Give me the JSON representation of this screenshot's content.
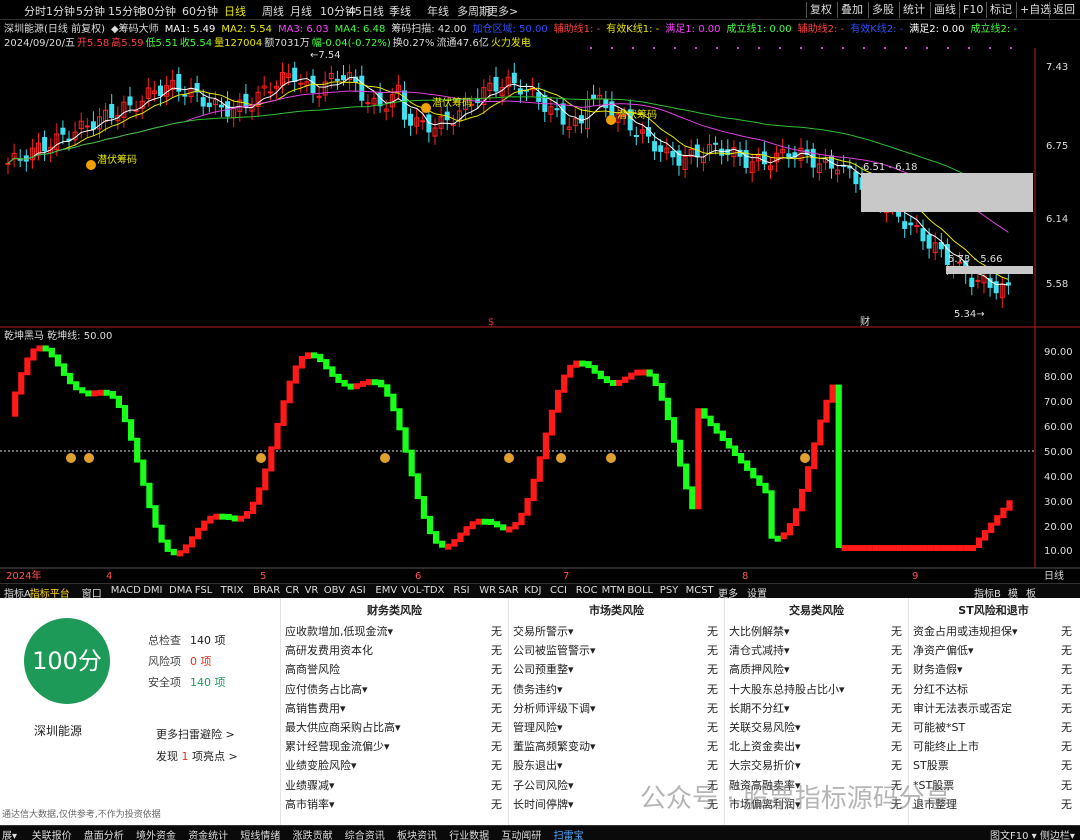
{
  "app": {
    "window_title": "深圳能源(日线 前复权)"
  },
  "periods": [
    "分时",
    "1分钟",
    "5分钟",
    "15分钟",
    "30分钟",
    "60分钟",
    "日线",
    "周线",
    "月线",
    "10分钟",
    "45日线",
    "季线",
    "年线",
    "多周期",
    "更多>"
  ],
  "active_period": "日线",
  "right_buttons": [
    "复权",
    "叠加",
    "多股",
    "统计",
    "画线",
    "F10",
    "标记",
    "+自选",
    "返回"
  ],
  "indicator_line": [
    {
      "t": "深圳能源(日线 前复权)",
      "c": "#dddddd"
    },
    {
      "t": "◆筹码大师",
      "c": "#dddddd"
    },
    {
      "t": "MA1: 5.49",
      "c": "#ffffff"
    },
    {
      "t": "MA2: 5.54",
      "c": "#e8e800"
    },
    {
      "t": "MA3: 6.03",
      "c": "#ff40ff"
    },
    {
      "t": "MA4: 6.48",
      "c": "#40ff40"
    },
    {
      "t": "筹码扫描: 42.00",
      "c": "#dddddd"
    },
    {
      "t": "加仓区域: 50.00",
      "c": "#2f4fff"
    },
    {
      "t": "辅助线1: -",
      "c": "#ff4040"
    },
    {
      "t": "有效K线1: -",
      "c": "#e8e800"
    },
    {
      "t": "满足1: 0.00",
      "c": "#ff40ff"
    },
    {
      "t": "成立线1: 0.00",
      "c": "#40ff40"
    },
    {
      "t": "辅助线2: -",
      "c": "#ff4040"
    },
    {
      "t": "有效K线2: -",
      "c": "#2f4fff"
    },
    {
      "t": "满足2: 0.00",
      "c": "#ffffff"
    },
    {
      "t": "成立线2: -",
      "c": "#40ff40"
    }
  ],
  "quote_line": [
    {
      "t": "2024/09/20/五",
      "c": "#dddddd"
    },
    {
      "t": "开5.58",
      "c": "#ff4040"
    },
    {
      "t": "高5.59",
      "c": "#ff4040"
    },
    {
      "t": "低5.51",
      "c": "#40ff40"
    },
    {
      "t": "收5.54",
      "c": "#40ff40"
    },
    {
      "t": "量127004",
      "c": "#e8e800"
    },
    {
      "t": "额7031万",
      "c": "#dddddd"
    },
    {
      "t": "幅-0.04(-0.72%)",
      "c": "#40ff40"
    },
    {
      "t": "换0.27%",
      "c": "#dddddd"
    },
    {
      "t": "流通47.6亿",
      "c": "#dddddd"
    },
    {
      "t": "火力发电",
      "c": "#e8e800"
    }
  ],
  "price_axis": [
    "7.43",
    "6.75",
    "6.14",
    "5.58"
  ],
  "osc_axis": [
    "90.00",
    "80.00",
    "70.00",
    "60.00",
    "50.00",
    "40.00",
    "30.00",
    "20.00",
    "10.00"
  ],
  "chart_annotations": {
    "high": "7.54",
    "low": "5.34",
    "zone1": "6.51 - 6.18",
    "zone2": "5.73 - 5.66",
    "cai": "财",
    "s": "$",
    "tag": "潜伏筹码"
  },
  "osc_title": "乾坤黑马  乾坤线: 50.00",
  "date_axis": [
    "2024年",
    "4",
    "5",
    "6",
    "7",
    "8",
    "9"
  ],
  "date_axis_right": "日线",
  "indicator_tabs": [
    "指标A",
    "指标平台",
    "窗口",
    "MACD",
    "DMI",
    "DMA",
    "FSL",
    "TRIX",
    "BRAR",
    "CR",
    "VR",
    "OBV",
    "ASI",
    "EMV",
    "VOL-TDX",
    "RSI",
    "WR",
    "SAR",
    "KDJ",
    "CCI",
    "ROC",
    "MTM",
    "BOLL",
    "PSY",
    "MCST",
    "更多",
    "设置"
  ],
  "indicator_tabs_right": [
    "指标B",
    "模",
    "板"
  ],
  "score_panel": {
    "score": "100分",
    "name": "深圳能源",
    "total_label": "总检查",
    "total_value": "140 项",
    "risk_label": "风险项",
    "risk_value": "0 项",
    "safe_label": "安全项",
    "safe_value": "140 项",
    "more": "更多扫雷避险 >",
    "highlight_prefix": "发现",
    "highlight_count": "1",
    "highlight_suffix": "项亮点 >",
    "disclaimer": "通达信大数据,仅供参考,不作为投资依据"
  },
  "risk_columns": [
    {
      "title": "财务类风险",
      "items": [
        [
          "应收款增加,低现金流▾",
          "无"
        ],
        [
          "高研发费用资本化",
          "无"
        ],
        [
          "高商誉风险",
          "无"
        ],
        [
          "应付债务占比高▾",
          "无"
        ],
        [
          "高销售费用▾",
          "无"
        ],
        [
          "最大供应商采购占比高▾",
          "无"
        ],
        [
          "累计经营现金流偏少▾",
          "无"
        ],
        [
          "业绩变脸风险▾",
          "无"
        ],
        [
          "业绩骤减▾",
          "无"
        ],
        [
          "高市销率▾",
          "无"
        ]
      ]
    },
    {
      "title": "市场类风险",
      "items": [
        [
          "交易所警示▾",
          "无"
        ],
        [
          "公司被监管警示▾",
          "无"
        ],
        [
          "公司预重整▾",
          "无"
        ],
        [
          "债务违约▾",
          "无"
        ],
        [
          "分析师评级下调▾",
          "无"
        ],
        [
          "管理风险▾",
          "无"
        ],
        [
          "董监高频繁变动▾",
          "无"
        ],
        [
          "股东退出▾",
          "无"
        ],
        [
          "子公司风险▾",
          "无"
        ],
        [
          "长时间停牌▾",
          "无"
        ]
      ]
    },
    {
      "title": "交易类风险",
      "items": [
        [
          "大比例解禁▾",
          "无"
        ],
        [
          "清仓式减持▾",
          "无"
        ],
        [
          "高质押风险▾",
          "无"
        ],
        [
          "十大股东总持股占比小▾",
          "无"
        ],
        [
          "长期不分红▾",
          "无"
        ],
        [
          "关联交易风险▾",
          "无"
        ],
        [
          "北上资金卖出▾",
          "无"
        ],
        [
          "大宗交易折价▾",
          "无"
        ],
        [
          "融资高融卖率▾",
          "无"
        ],
        [
          "市场偏离利润▾",
          "无"
        ]
      ]
    },
    {
      "title": "ST风险和退市",
      "items": [
        [
          "资金占用或违规担保▾",
          "无"
        ],
        [
          "净资产偏低▾",
          "无"
        ],
        [
          "财务造假▾",
          "无"
        ],
        [
          "分红不达标",
          "无"
        ],
        [
          "审计无法表示或否定",
          "无"
        ],
        [
          "可能被*ST",
          "无"
        ],
        [
          "可能终止上市",
          "无"
        ],
        [
          "ST股票",
          "无"
        ],
        [
          "*ST股票",
          "无"
        ],
        [
          "退市整理",
          "无"
        ]
      ]
    }
  ],
  "bottom_tabs": [
    "展▾",
    "关联报价",
    "盘面分析",
    "境外资金",
    "资金统计",
    "短线情绪",
    "涨跌贡献",
    "综合资讯",
    "板块资讯",
    "行业数据",
    "互动闻研",
    "扫雷宝"
  ],
  "bottom_right": "图文F10 ▾ 侧边栏▾",
  "watermark": "公众号 · 股票指标源码分享",
  "colors": {
    "up": "#ff2020",
    "down": "#20ff20",
    "cyan": "#40e0f0",
    "ma1": "#ffffff",
    "ma2": "#e8e800",
    "ma3": "#e040e0",
    "ma4": "#30c030",
    "score": "#1e9a58"
  }
}
